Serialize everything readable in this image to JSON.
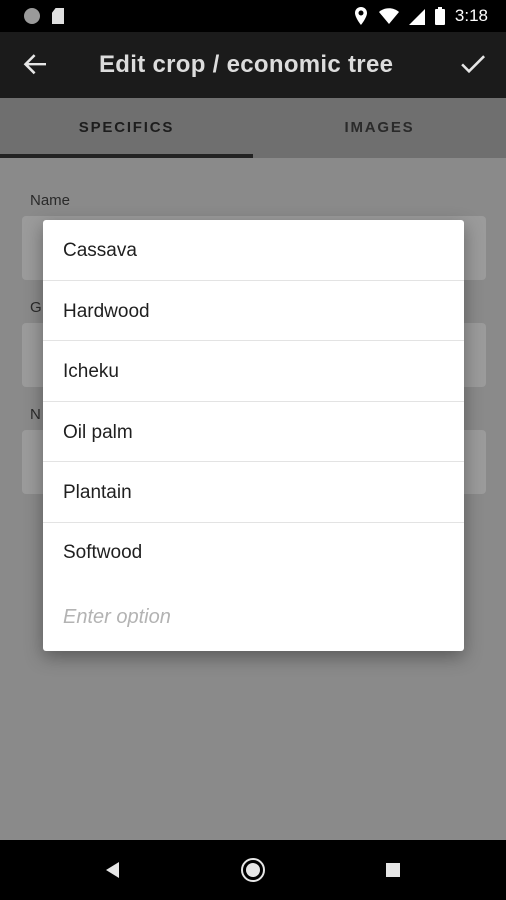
{
  "status_bar": {
    "time": "3:18"
  },
  "app_bar": {
    "title": "Edit crop / economic tree"
  },
  "tabs": [
    {
      "label": "SPECIFICS"
    },
    {
      "label": "IMAGES"
    }
  ],
  "form": {
    "name_label": "Name",
    "partial_label_1": "G",
    "partial_label_2": "N"
  },
  "dropdown": {
    "options": [
      {
        "label": "Cassava"
      },
      {
        "label": "Hardwood"
      },
      {
        "label": "Icheku"
      },
      {
        "label": "Oil palm"
      },
      {
        "label": "Plantain"
      },
      {
        "label": "Softwood"
      }
    ],
    "input_placeholder": "Enter option"
  },
  "colors": {
    "status_bar": "#000000",
    "app_bar": "#1b1b1b",
    "overlay": "#8a8a8a",
    "dialog": "#ffffff"
  }
}
